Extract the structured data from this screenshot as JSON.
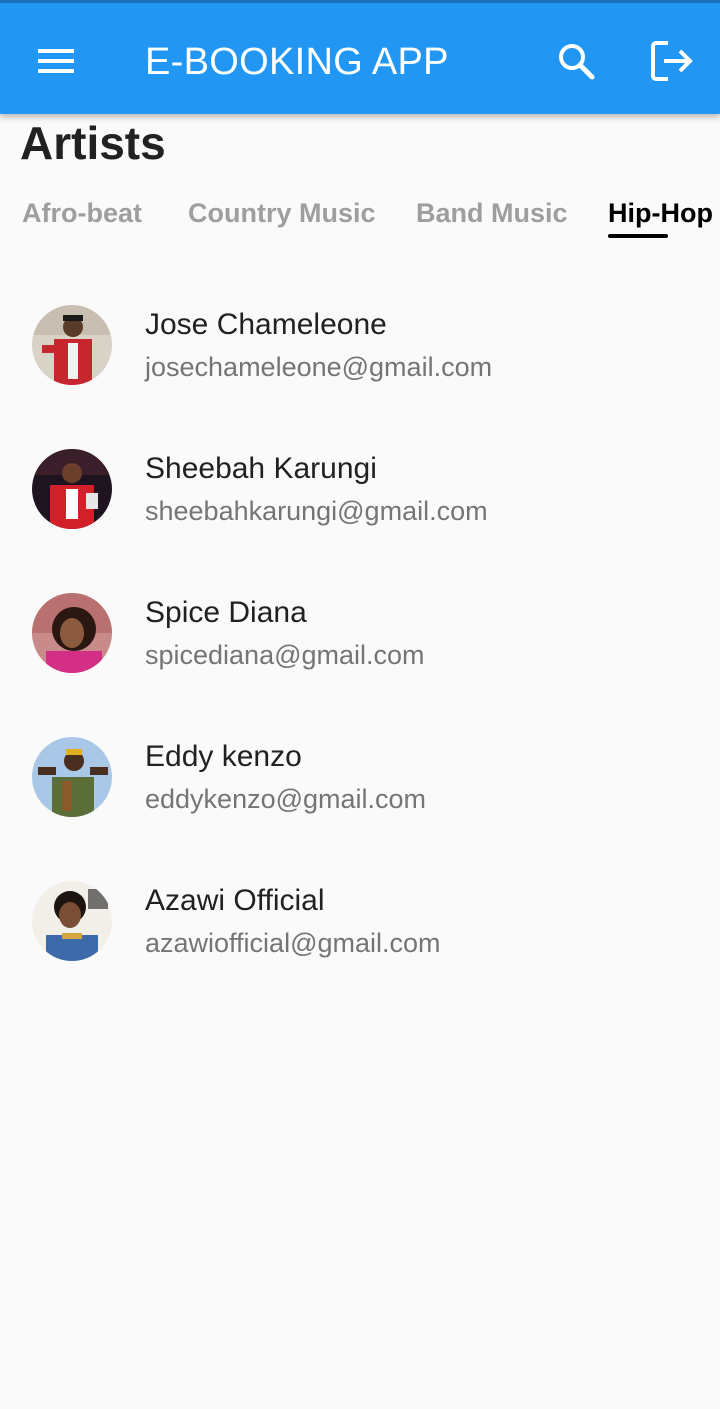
{
  "appbar": {
    "title": "E-BOOKING APP",
    "background": "#2196f3",
    "menu_icon": "hamburger-menu-icon",
    "search_icon": "search-icon",
    "logout_icon": "logout-icon"
  },
  "page": {
    "heading": "Artists"
  },
  "tabs": [
    {
      "label": "Afro-beat",
      "active": false
    },
    {
      "label": "Country Music",
      "active": false
    },
    {
      "label": "Band Music",
      "active": false
    },
    {
      "label": "Hip-Hop",
      "active": true
    }
  ],
  "artists": [
    {
      "name": "Jose Chameleone",
      "email": "josechameleone@gmail.com"
    },
    {
      "name": "Sheebah Karungi",
      "email": "sheebahkarungi@gmail.com"
    },
    {
      "name": "Spice Diana",
      "email": "spicediana@gmail.com"
    },
    {
      "name": "Eddy kenzo",
      "email": "eddykenzo@gmail.com"
    },
    {
      "name": "Azawi Official",
      "email": "azawiofficial@gmail.com"
    }
  ]
}
